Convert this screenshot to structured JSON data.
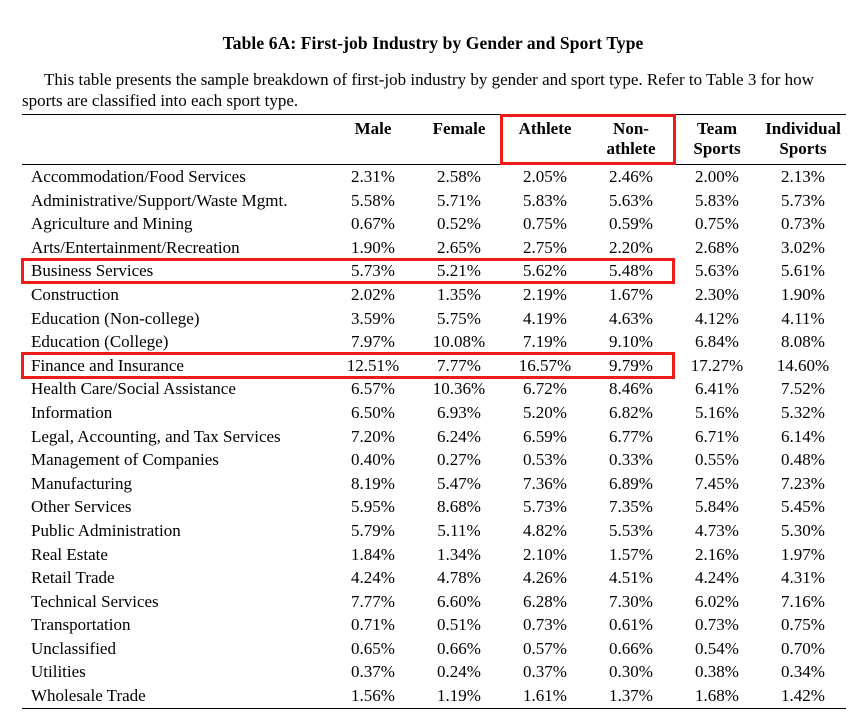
{
  "title": "Table 6A: First-job Industry by Gender and Sport Type",
  "caption": "This table presents the sample breakdown of first-job industry by gender and sport type. Refer to Table 3 for how sports are classified into each sport type.",
  "table": {
    "row_header_label": "",
    "columns": [
      {
        "label": "Male",
        "label_line2": ""
      },
      {
        "label": "Female",
        "label_line2": ""
      },
      {
        "label": "Athlete",
        "label_line2": ""
      },
      {
        "label": "Non-",
        "label_line2": "athlete"
      },
      {
        "label": "Team",
        "label_line2": "Sports"
      },
      {
        "label": "Individual",
        "label_line2": "Sports"
      }
    ],
    "rows": [
      {
        "label": "Accommodation/Food Services",
        "values": [
          "2.31%",
          "2.58%",
          "2.05%",
          "2.46%",
          "2.00%",
          "2.13%"
        ],
        "highlighted": false
      },
      {
        "label": "Administrative/Support/Waste Mgmt.",
        "values": [
          "5.58%",
          "5.71%",
          "5.83%",
          "5.63%",
          "5.83%",
          "5.73%"
        ],
        "highlighted": false
      },
      {
        "label": "Agriculture and Mining",
        "values": [
          "0.67%",
          "0.52%",
          "0.75%",
          "0.59%",
          "0.75%",
          "0.73%"
        ],
        "highlighted": false
      },
      {
        "label": "Arts/Entertainment/Recreation",
        "values": [
          "1.90%",
          "2.65%",
          "2.75%",
          "2.20%",
          "2.68%",
          "3.02%"
        ],
        "highlighted": false
      },
      {
        "label": "Business Services",
        "values": [
          "5.73%",
          "5.21%",
          "5.62%",
          "5.48%",
          "5.63%",
          "5.61%"
        ],
        "highlighted": true
      },
      {
        "label": "Construction",
        "values": [
          "2.02%",
          "1.35%",
          "2.19%",
          "1.67%",
          "2.30%",
          "1.90%"
        ],
        "highlighted": false
      },
      {
        "label": "Education (Non-college)",
        "values": [
          "3.59%",
          "5.75%",
          "4.19%",
          "4.63%",
          "4.12%",
          "4.11%"
        ],
        "highlighted": false
      },
      {
        "label": "Education (College)",
        "values": [
          "7.97%",
          "10.08%",
          "7.19%",
          "9.10%",
          "6.84%",
          "8.08%"
        ],
        "highlighted": false
      },
      {
        "label": "Finance and Insurance",
        "values": [
          "12.51%",
          "7.77%",
          "16.57%",
          "9.79%",
          "17.27%",
          "14.60%"
        ],
        "highlighted": true
      },
      {
        "label": "Health Care/Social Assistance",
        "values": [
          "6.57%",
          "10.36%",
          "6.72%",
          "8.46%",
          "6.41%",
          "7.52%"
        ],
        "highlighted": false
      },
      {
        "label": "Information",
        "values": [
          "6.50%",
          "6.93%",
          "5.20%",
          "6.82%",
          "5.16%",
          "5.32%"
        ],
        "highlighted": false
      },
      {
        "label": "Legal, Accounting, and Tax Services",
        "values": [
          "7.20%",
          "6.24%",
          "6.59%",
          "6.77%",
          "6.71%",
          "6.14%"
        ],
        "highlighted": false
      },
      {
        "label": "Management of Companies",
        "values": [
          "0.40%",
          "0.27%",
          "0.53%",
          "0.33%",
          "0.55%",
          "0.48%"
        ],
        "highlighted": false
      },
      {
        "label": "Manufacturing",
        "values": [
          "8.19%",
          "5.47%",
          "7.36%",
          "6.89%",
          "7.45%",
          "7.23%"
        ],
        "highlighted": false
      },
      {
        "label": "Other Services",
        "values": [
          "5.95%",
          "8.68%",
          "5.73%",
          "7.35%",
          "5.84%",
          "5.45%"
        ],
        "highlighted": false
      },
      {
        "label": "Public Administration",
        "values": [
          "5.79%",
          "5.11%",
          "4.82%",
          "5.53%",
          "4.73%",
          "5.30%"
        ],
        "highlighted": false
      },
      {
        "label": "Real Estate",
        "values": [
          "1.84%",
          "1.34%",
          "2.10%",
          "1.57%",
          "2.16%",
          "1.97%"
        ],
        "highlighted": false
      },
      {
        "label": "Retail Trade",
        "values": [
          "4.24%",
          "4.78%",
          "4.26%",
          "4.51%",
          "4.24%",
          "4.31%"
        ],
        "highlighted": false
      },
      {
        "label": "Technical Services",
        "values": [
          "7.77%",
          "6.60%",
          "6.28%",
          "7.30%",
          "6.02%",
          "7.16%"
        ],
        "highlighted": false
      },
      {
        "label": "Transportation",
        "values": [
          "0.71%",
          "0.51%",
          "0.73%",
          "0.61%",
          "0.73%",
          "0.75%"
        ],
        "highlighted": false
      },
      {
        "label": "Unclassified",
        "values": [
          "0.65%",
          "0.66%",
          "0.57%",
          "0.66%",
          "0.54%",
          "0.70%"
        ],
        "highlighted": false
      },
      {
        "label": "Utilities",
        "values": [
          "0.37%",
          "0.24%",
          "0.37%",
          "0.30%",
          "0.38%",
          "0.34%"
        ],
        "highlighted": false
      },
      {
        "label": "Wholesale Trade",
        "values": [
          "1.56%",
          "1.19%",
          "1.61%",
          "1.37%",
          "1.68%",
          "1.42%"
        ],
        "highlighted": false
      }
    ]
  },
  "annotations": {
    "highlight_color": "#ee1c16",
    "boxes": [
      {
        "name": "header-athlete-nonathlete-box"
      },
      {
        "name": "row-business-services-box"
      },
      {
        "name": "row-finance-and-insurance-box"
      }
    ]
  }
}
